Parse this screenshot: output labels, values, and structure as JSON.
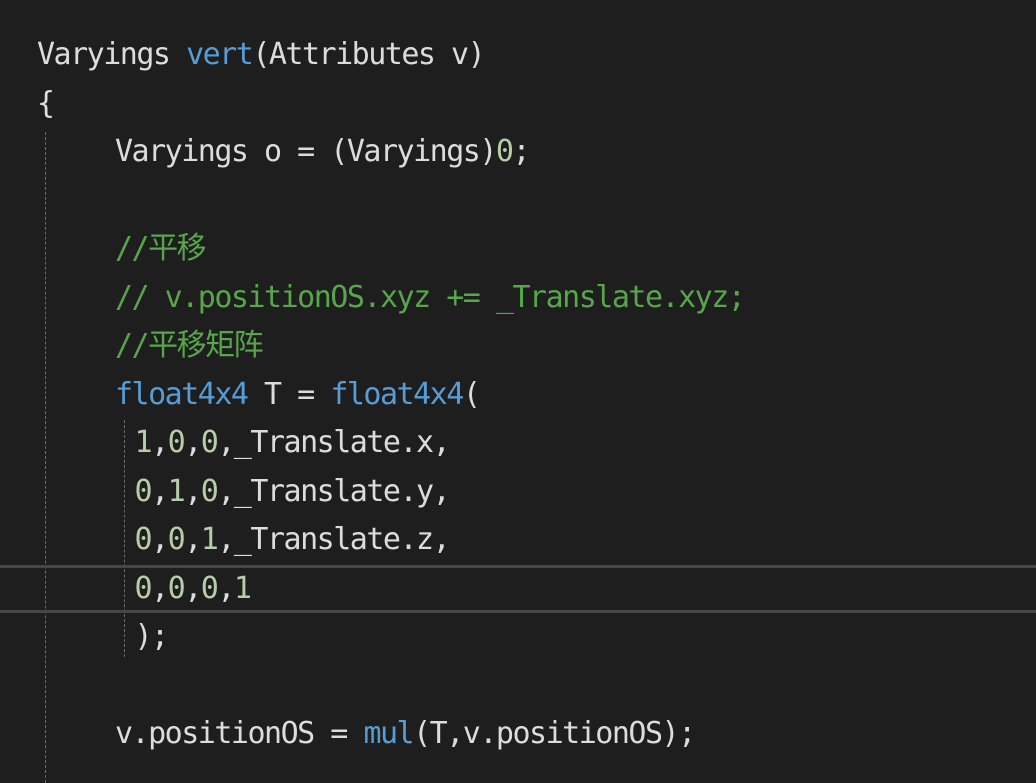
{
  "colors": {
    "background": "#1e1e1e",
    "default": "#dcdcdc",
    "keyword": "#569cd6",
    "comment": "#57a64a",
    "number": "#b5cea8",
    "current_line_border": "#464646",
    "indent_guide": "#6b6b6b"
  },
  "lines": [
    {
      "indent": 0,
      "tokens": [
        {
          "text": "Varyings ",
          "kind": "default"
        },
        {
          "text": "vert",
          "kind": "keyword"
        },
        {
          "text": "(Attributes v)",
          "kind": "default"
        }
      ]
    },
    {
      "indent": 0,
      "tokens": [
        {
          "text": "{",
          "kind": "default"
        }
      ]
    },
    {
      "indent": 2,
      "tokens": [
        {
          "text": "Varyings o = (Varyings)",
          "kind": "default"
        },
        {
          "text": "0",
          "kind": "number"
        },
        {
          "text": ";",
          "kind": "default"
        }
      ]
    },
    {
      "indent": 0,
      "tokens": []
    },
    {
      "indent": 2,
      "tokens": [
        {
          "text": "//平移",
          "kind": "comment"
        }
      ]
    },
    {
      "indent": 2,
      "tokens": [
        {
          "text": "// v.positionOS.xyz += _Translate.xyz;",
          "kind": "comment"
        }
      ]
    },
    {
      "indent": 2,
      "tokens": [
        {
          "text": "//平移矩阵",
          "kind": "comment"
        }
      ]
    },
    {
      "indent": 2,
      "tokens": [
        {
          "text": "float4x4",
          "kind": "keyword"
        },
        {
          "text": " T = ",
          "kind": "default"
        },
        {
          "text": "float4x4",
          "kind": "keyword"
        },
        {
          "text": "(",
          "kind": "default"
        }
      ]
    },
    {
      "indent": 2.5,
      "tokens": [
        {
          "text": "1",
          "kind": "number"
        },
        {
          "text": ",",
          "kind": "default"
        },
        {
          "text": "0",
          "kind": "number"
        },
        {
          "text": ",",
          "kind": "default"
        },
        {
          "text": "0",
          "kind": "number"
        },
        {
          "text": ",_Translate.x,",
          "kind": "default"
        }
      ]
    },
    {
      "indent": 2.5,
      "tokens": [
        {
          "text": "0",
          "kind": "number"
        },
        {
          "text": ",",
          "kind": "default"
        },
        {
          "text": "1",
          "kind": "number"
        },
        {
          "text": ",",
          "kind": "default"
        },
        {
          "text": "0",
          "kind": "number"
        },
        {
          "text": ",_Translate.y,",
          "kind": "default"
        }
      ]
    },
    {
      "indent": 2.5,
      "tokens": [
        {
          "text": "0",
          "kind": "number"
        },
        {
          "text": ",",
          "kind": "default"
        },
        {
          "text": "0",
          "kind": "number"
        },
        {
          "text": ",",
          "kind": "default"
        },
        {
          "text": "1",
          "kind": "number"
        },
        {
          "text": ",_Translate.z,",
          "kind": "default"
        }
      ]
    },
    {
      "indent": 2.5,
      "current": true,
      "tokens": [
        {
          "text": "0",
          "kind": "number"
        },
        {
          "text": ",",
          "kind": "default"
        },
        {
          "text": "0",
          "kind": "number"
        },
        {
          "text": ",",
          "kind": "default"
        },
        {
          "text": "0",
          "kind": "number"
        },
        {
          "text": ",",
          "kind": "default"
        },
        {
          "text": "1",
          "kind": "number"
        }
      ]
    },
    {
      "indent": 2.5,
      "tokens": [
        {
          "text": ");",
          "kind": "default"
        }
      ]
    },
    {
      "indent": 0,
      "tokens": []
    },
    {
      "indent": 2,
      "tokens": [
        {
          "text": "v.positionOS = ",
          "kind": "default"
        },
        {
          "text": "mul",
          "kind": "keyword"
        },
        {
          "text": "(T,v.positionOS);",
          "kind": "default"
        }
      ]
    }
  ]
}
